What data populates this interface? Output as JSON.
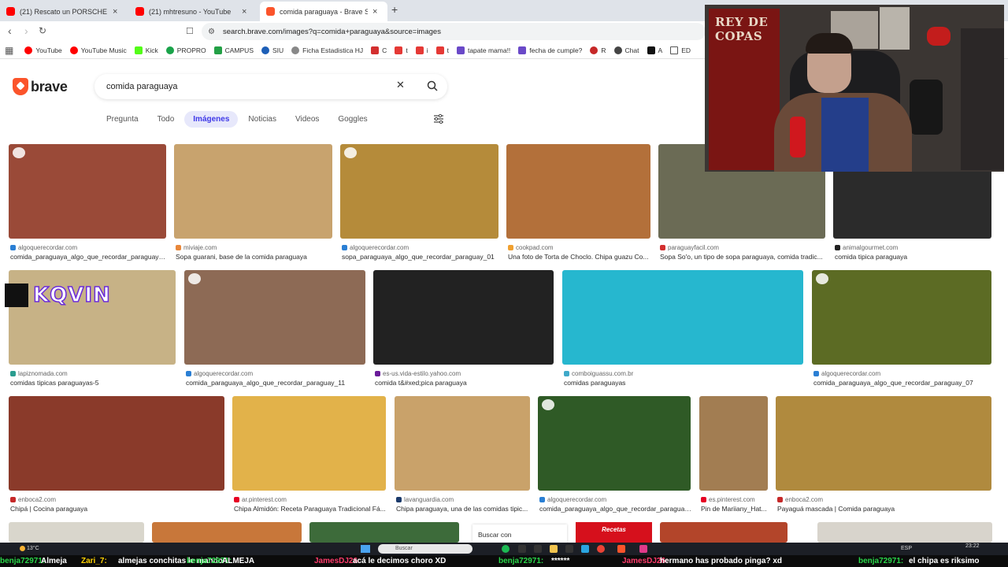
{
  "tabs": [
    {
      "title": "(21) Rescato un PORSCHE TURBO S A",
      "favicon_color": "#ff0000"
    },
    {
      "title": "(21) mhtresuno - YouTube",
      "favicon_color": "#ff0000"
    },
    {
      "title": "comida paraguaya - Brave Searc",
      "favicon_color": "#fb542b"
    }
  ],
  "address": {
    "url": "search.brave.com/images?q=comida+paraguaya&source=images"
  },
  "bookmarks": [
    {
      "label": "YouTube",
      "color": "#ff0000"
    },
    {
      "label": "YouTube Music",
      "color": "#ff0000"
    },
    {
      "label": "Kick",
      "color": "#53fc18"
    },
    {
      "label": "PROPRO",
      "color": "#1aa34a"
    },
    {
      "label": "CAMPUS",
      "color": "#23a046"
    },
    {
      "label": "SIU",
      "color": "#1d5fb7"
    },
    {
      "label": "Ficha Estadistica HJ",
      "color": "#888888"
    },
    {
      "label": "C",
      "color": "#d32f2f"
    },
    {
      "label": "t",
      "color": "#e53935"
    },
    {
      "label": "i",
      "color": "#e53935"
    },
    {
      "label": "t",
      "color": "#e53935"
    },
    {
      "label": "tapate mama!!",
      "color": "#6a49c8"
    },
    {
      "label": "fecha de cumple?",
      "color": "#6a49c8"
    },
    {
      "label": "R",
      "color": "#c62828"
    },
    {
      "label": "Chat",
      "color": "#444444"
    },
    {
      "label": "A",
      "color": "#111111"
    },
    {
      "label": "ED",
      "color": "#555555"
    }
  ],
  "search": {
    "query": "comida paraguaya",
    "logo": "brave"
  },
  "nav_tabs": [
    "Pregunta",
    "Todo",
    "Imágenes",
    "Noticias",
    "Videos",
    "Goggles"
  ],
  "active_tab": "Imágenes",
  "results": [
    {
      "source": "algoquerecordar.com",
      "caption": "comida_paraguaya_algo_que_recordar_paraguay_03",
      "color": "#9a4a38",
      "icon_color": "#2a7fd4"
    },
    {
      "source": "miviaje.com",
      "caption": "Sopa guarani, base de la comida paraguaya",
      "color": "#c8a36e",
      "icon_color": "#e8873a"
    },
    {
      "source": "algoquerecordar.com",
      "caption": "sopa_paraguaya_algo_que_recordar_paraguay_01",
      "color": "#b58b3a",
      "icon_color": "#2a7fd4"
    },
    {
      "source": "cookpad.com",
      "caption": "Una foto de Torta de Choclo. Chipa guazu Co...",
      "color": "#b3703a",
      "icon_color": "#f0a030"
    },
    {
      "source": "paraguayfacil.com",
      "caption": "Sopa So'o, un tipo de sopa paraguaya, comida tradic...",
      "color": "#6b6b55",
      "icon_color": "#d32f2f"
    },
    {
      "source": "animalgourmet.com",
      "caption": "comida tipica paraguaya",
      "color": "#2b2b2b",
      "icon_color": "#222222"
    },
    {
      "source": "lapiznomada.com",
      "caption": "comidas tipicas paraguayas-5",
      "color": "#c7b286",
      "icon_color": "#2a9d8f"
    },
    {
      "source": "algoquerecordar.com",
      "caption": "comida_paraguaya_algo_que_recordar_paraguay_11",
      "color": "#8d6a55",
      "icon_color": "#2a7fd4"
    },
    {
      "source": "es-us.vida-estilo.yahoo.com",
      "caption": "comida t&#xed;pica paraguaya",
      "color": "#222222",
      "icon_color": "#6a1b9a"
    },
    {
      "source": "comboiguassu.com.br",
      "caption": "comidas paraguayas",
      "color": "#26b7cf",
      "icon_color": "#3fa9c9"
    },
    {
      "source": "algoquerecordar.com",
      "caption": "comida_paraguaya_algo_que_recordar_paraguay_07",
      "color": "#5c6b24",
      "icon_color": "#2a7fd4"
    },
    {
      "source": "enboca2.com",
      "caption": "Chipá | Cocina paraguaya",
      "color": "#8a3a2a",
      "icon_color": "#c62828"
    },
    {
      "source": "ar.pinterest.com",
      "caption": "Chipa Almidón: Receta Paraguaya Tradicional Fá...",
      "color": "#e2b24a",
      "icon_color": "#e60023"
    },
    {
      "source": "lavanguardia.com",
      "caption": "Chipa paraguaya, una de las comidas tipic...",
      "color": "#c9a26a",
      "icon_color": "#1b3a6b"
    },
    {
      "source": "algoquerecordar.com",
      "caption": "comida_paraguaya_algo_que_recordar_paraguay...",
      "color": "#2f5a26",
      "icon_color": "#2a7fd4"
    },
    {
      "source": "es.pinterest.com",
      "caption": "Pin de Mariiany_Hat...",
      "color": "#a27d52",
      "icon_color": "#e60023"
    },
    {
      "source": "enboca2.com",
      "caption": "Payaguá mascada | Comida paraguaya",
      "color": "#b08a3e",
      "icon_color": "#c62828"
    }
  ],
  "partial_row": {
    "buscar_con": "Buscar con",
    "badge": "Recetas"
  },
  "overlay": {
    "kqvin": "KQVIN",
    "flag_text": "REY DE COPAS"
  },
  "taskbar": {
    "weather": "13°C",
    "search_placeholder": "Buscar",
    "lang": "ESP",
    "time": "23:22"
  },
  "ticker": [
    {
      "user": "benja72971",
      "msg": "Almeja",
      "color": "#29d649"
    },
    {
      "user": "Zari_7",
      "msg": "almejas  conchitas le mando",
      "color": "#ffd200"
    },
    {
      "user": "benja72971",
      "msg": "ALMEJA",
      "color": "#29d649"
    },
    {
      "user": "JamesDJ26",
      "msg": "acá le decimos choro  XD",
      "color": "#ff3b6b"
    },
    {
      "user": "benja72971",
      "msg": "******",
      "color": "#29d649"
    },
    {
      "user": "JamesDJ26",
      "msg": "hermano has probado pinga? xd",
      "color": "#ff3b6b"
    },
    {
      "user": "benja72971",
      "msg": "el chipa  es riksimo",
      "color": "#29d649"
    }
  ]
}
